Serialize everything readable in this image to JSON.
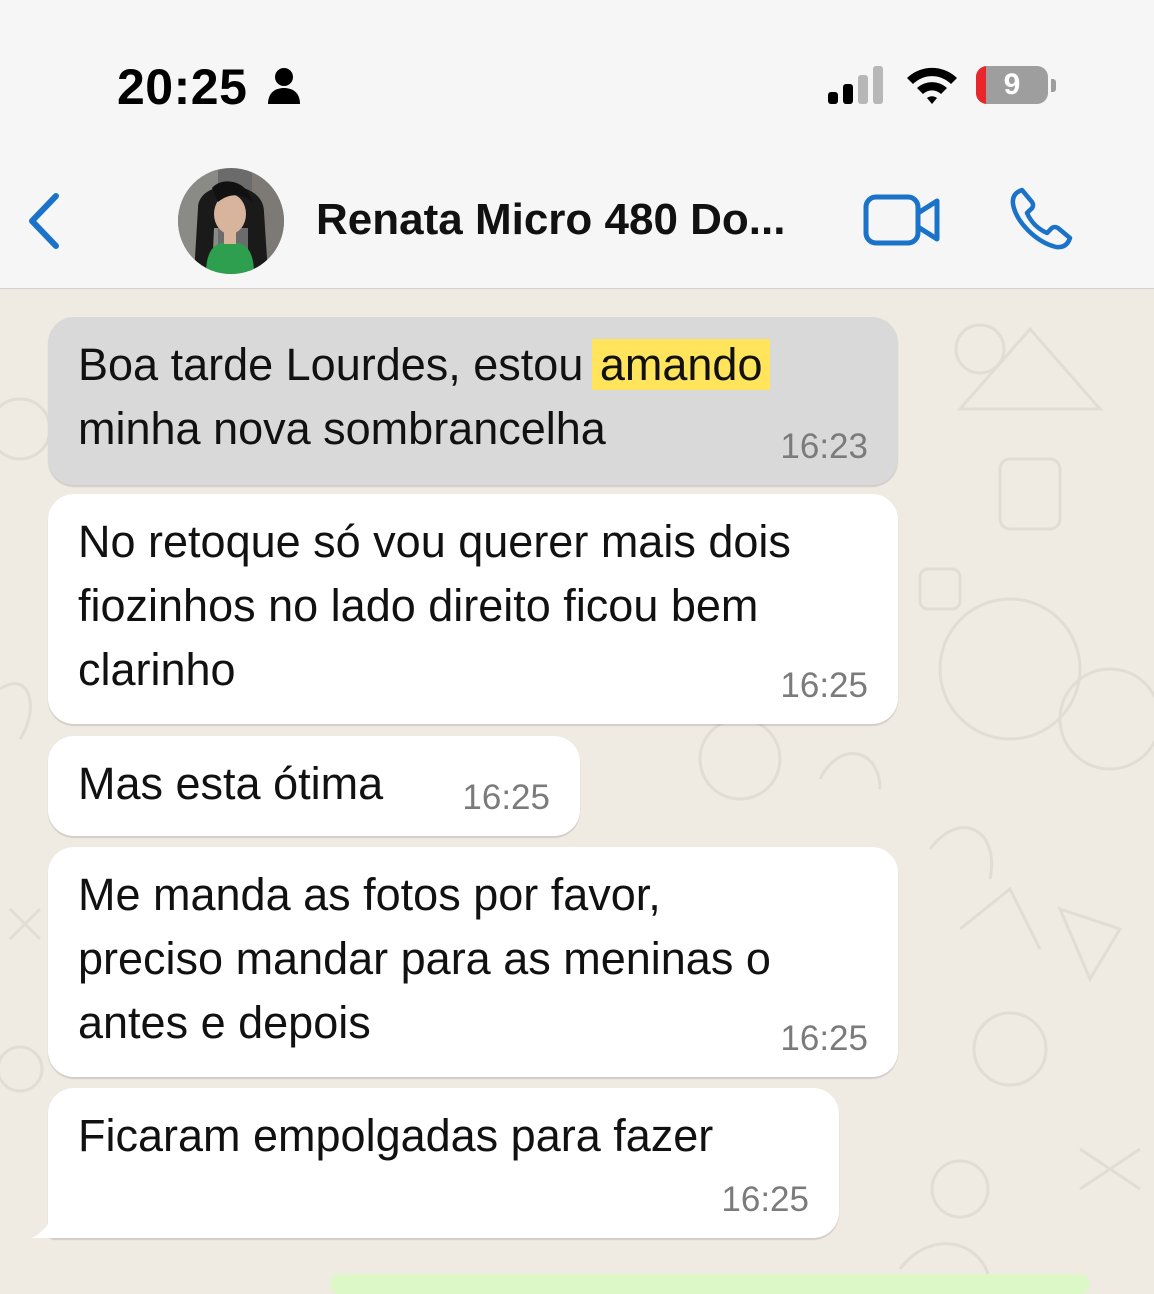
{
  "status_bar": {
    "time": "20:25",
    "battery_level": "9",
    "icons": [
      "person-icon",
      "cellular-signal-icon",
      "wifi-icon",
      "battery-icon"
    ]
  },
  "header": {
    "contact_name": "Renata Micro 480 Do...",
    "icons": [
      "back-chevron-icon",
      "video-call-icon",
      "phone-call-icon"
    ],
    "accent_color": "#1a73c8"
  },
  "messages": [
    {
      "line1_prefix": "Boa tarde Lourdes, estou ",
      "highlight": "amando",
      "line2": "minha nova sombrancelha",
      "time": "16:23",
      "selected": true
    },
    {
      "lines": [
        "No retoque só vou querer mais dois",
        "fiozinhos no lado direito ficou bem",
        "clarinho"
      ],
      "time": "16:25"
    },
    {
      "lines": [
        "Mas esta ótima"
      ],
      "time": "16:25"
    },
    {
      "lines": [
        "Me manda as fotos por favor,",
        "preciso mandar para as meninas o",
        "antes e depois"
      ],
      "time": "16:25"
    },
    {
      "lines": [
        "Ficaram empolgadas para fazer"
      ],
      "time": "16:25"
    }
  ],
  "colors": {
    "chat_background": "#efeae2",
    "incoming_bubble": "#ffffff",
    "selected_bubble": "#d9d9d9",
    "search_highlight": "#ffe45c",
    "battery_low": "#e8262b"
  }
}
